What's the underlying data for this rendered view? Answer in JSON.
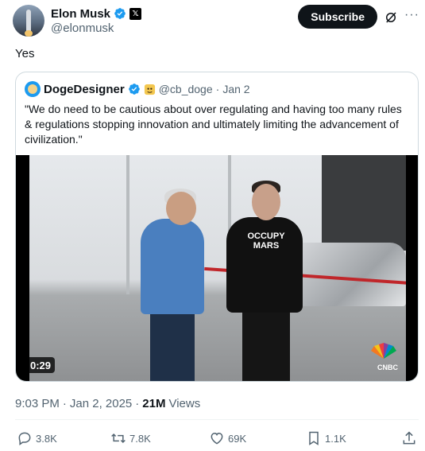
{
  "author": {
    "display_name": "Elon Musk",
    "handle": "@elonmusk",
    "affiliate_badge": "𝕏"
  },
  "header": {
    "subscribe_label": "Subscribe",
    "more_glyph": "···"
  },
  "tweet": {
    "text": "Yes"
  },
  "quote": {
    "display_name": "DogeDesigner",
    "handle": "@cb_doge",
    "separator": "·",
    "date": "Jan 2",
    "text": "\"We do need to be cautious about  over regulating and having too many rules & regulations stopping innovation and ultimately limiting the advancement of civilization.\"",
    "video": {
      "duration": "0:29",
      "shirt_text": "OCCUPY MARS",
      "watermark": "CNBC"
    }
  },
  "meta": {
    "time": "9:03 PM",
    "separator": "·",
    "date": "Jan 2, 2025",
    "views_count": "21M",
    "views_label": "Views"
  },
  "actions": {
    "replies": "3.8K",
    "reposts": "7.8K",
    "likes": "69K",
    "bookmarks": "1.1K"
  },
  "colors": {
    "text_primary": "#0f1419",
    "text_secondary": "#536471",
    "verified_blue": "#1d9bf0",
    "border": "#cfd9de"
  },
  "icons": [
    "verified-icon",
    "x-affiliate-icon",
    "grok-icon",
    "more-icon",
    "reply-icon",
    "repost-icon",
    "like-icon",
    "bookmark-icon",
    "share-icon"
  ]
}
